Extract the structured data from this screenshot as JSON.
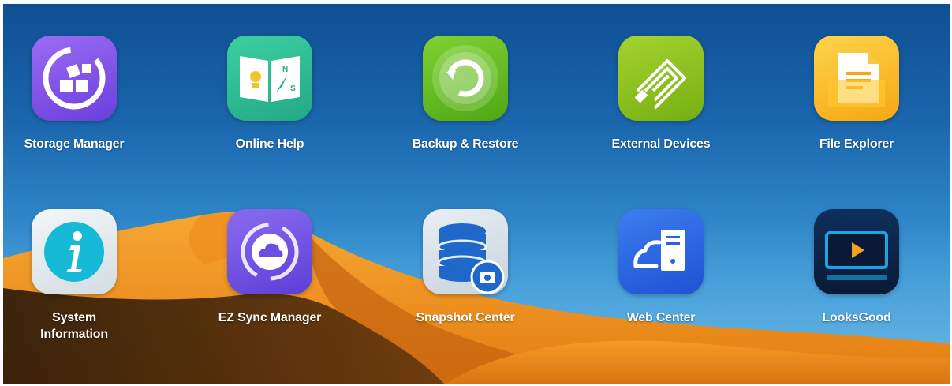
{
  "apps": [
    {
      "label": "Storage Manager",
      "icon": "storage-manager-icon",
      "color": "#7b54e6"
    },
    {
      "label": "Online Help",
      "icon": "online-help-icon",
      "color": "#2fbd93"
    },
    {
      "label": "Backup & Restore",
      "icon": "backup-restore-icon",
      "color": "#63bd1e"
    },
    {
      "label": "External Devices",
      "icon": "external-devices-icon",
      "color": "#8cc21d"
    },
    {
      "label": "File Explorer",
      "icon": "file-explorer-icon",
      "color": "#f7b51e"
    },
    {
      "label": "System\nInformation",
      "icon": "system-information-icon",
      "color": "#16b9d6"
    },
    {
      "label": "EZ Sync Manager",
      "icon": "ez-sync-manager-icon",
      "color": "#6d4fe0"
    },
    {
      "label": "Snapshot Center",
      "icon": "snapshot-center-icon",
      "color": "#1f67c9"
    },
    {
      "label": "Web Center",
      "icon": "web-center-icon",
      "color": "#2a63e0"
    },
    {
      "label": "LooksGood",
      "icon": "looksgood-icon",
      "color": "#19a6e6"
    }
  ],
  "wallpaper": {
    "sky": "#1a65ac",
    "dune": "#f2961f"
  }
}
